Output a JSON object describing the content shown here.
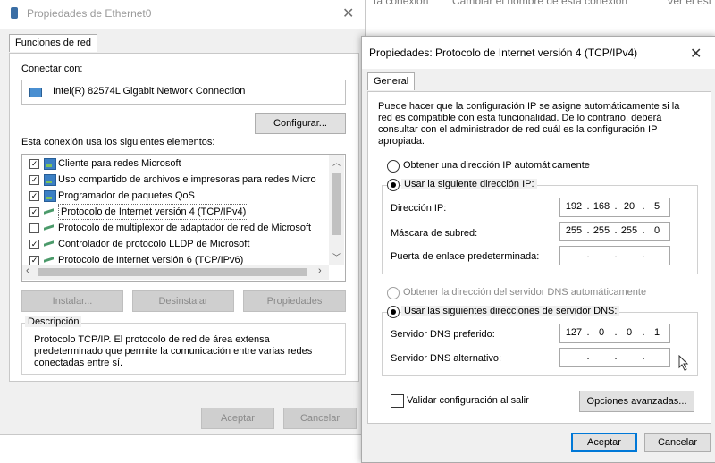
{
  "background": {
    "links": [
      "ta conexión",
      "Cambiar el nombre de esta conexión",
      "Ver el est"
    ]
  },
  "eth_window": {
    "title": "Propiedades de Ethernet0",
    "tab": "Funciones de red",
    "connect_using_label": "Conectar con:",
    "adapter": "Intel(R) 82574L Gigabit Network Connection",
    "configure_button": "Configurar...",
    "elements_label": "Esta conexión usa los siguientes elementos:",
    "items": [
      {
        "label": "Cliente para redes Microsoft",
        "checked": true,
        "icon": "network-client-icon"
      },
      {
        "label": "Uso compartido de archivos e impresoras para redes Micro",
        "checked": true,
        "icon": "file-sharing-icon"
      },
      {
        "label": "Programador de paquetes QoS",
        "checked": true,
        "icon": "qos-icon"
      },
      {
        "label": "Protocolo de Internet versión 4 (TCP/IPv4)",
        "checked": true,
        "icon": "protocol-icon"
      },
      {
        "label": "Protocolo de multiplexor de adaptador de red de Microsoft",
        "checked": false,
        "icon": "protocol-icon"
      },
      {
        "label": "Controlador de protocolo LLDP de Microsoft",
        "checked": true,
        "icon": "protocol-icon"
      },
      {
        "label": "Protocolo de Internet versión 6 (TCP/IPv6)",
        "checked": true,
        "icon": "protocol-icon"
      }
    ],
    "install_button": "Instalar...",
    "uninstall_button": "Desinstalar",
    "properties_button": "Propiedades",
    "description_title": "Descripción",
    "description_text": "Protocolo TCP/IP. El protocolo de red de área extensa predeterminado que permite la comunicación entre varias redes conectadas entre sí.",
    "ok_button": "Aceptar",
    "cancel_button": "Cancelar"
  },
  "ipv4_window": {
    "title": "Propiedades: Protocolo de Internet versión 4 (TCP/IPv4)",
    "tab": "General",
    "intro": "Puede hacer que la configuración IP se asigne automáticamente si la red es compatible con esta funcionalidad. De lo contrario, deberá consultar con el administrador de red cuál es la configuración IP apropiada.",
    "radio_auto_ip": "Obtener una dirección IP automáticamente",
    "radio_manual_ip": "Usar la siguiente dirección IP:",
    "ip_label": "Dirección IP:",
    "ip_value": [
      "192",
      "168",
      "20",
      "5"
    ],
    "mask_label": "Máscara de subred:",
    "mask_value": [
      "255",
      "255",
      "255",
      "0"
    ],
    "gateway_label": "Puerta de enlace predeterminada:",
    "radio_auto_dns": "Obtener la dirección del servidor DNS automáticamente",
    "radio_manual_dns": "Usar las siguientes direcciones de servidor DNS:",
    "dns1_label": "Servidor DNS preferido:",
    "dns1_value": [
      "127",
      "0",
      "0",
      "1"
    ],
    "dns2_label": "Servidor DNS alternativo:",
    "validate_label": "Validar configuración al salir",
    "validate_checked": false,
    "advanced_button": "Opciones avanzadas...",
    "ok_button": "Aceptar",
    "cancel_button": "Cancelar"
  }
}
